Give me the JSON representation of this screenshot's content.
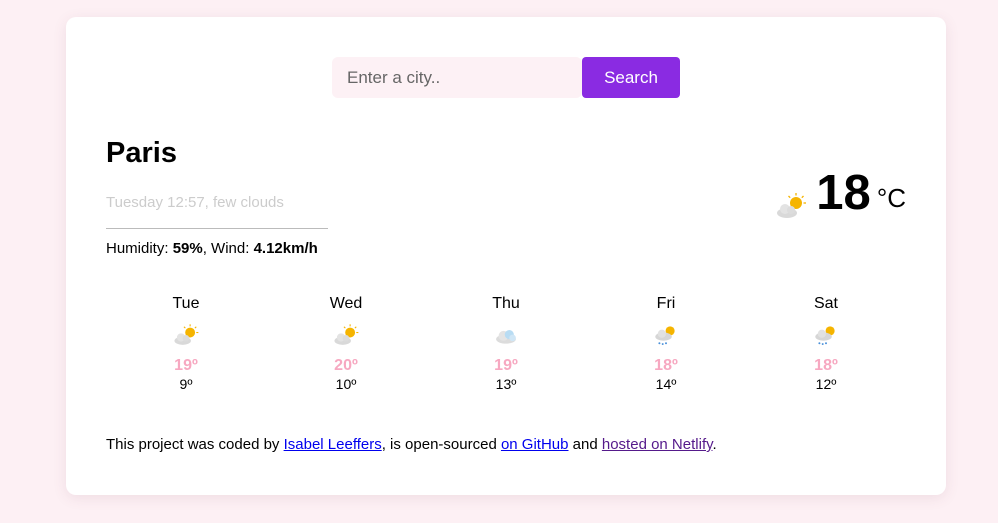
{
  "search": {
    "placeholder": "Enter a city..",
    "button_label": "Search"
  },
  "current": {
    "city": "Paris",
    "description": "Tuesday 12:57, few clouds",
    "humidity_label": "Humidity: ",
    "humidity_value": "59%",
    "wind_label": ", Wind: ",
    "wind_value": "4.12km/h",
    "temperature": "18",
    "unit": "°C",
    "icon": "few-clouds-icon"
  },
  "forecast": [
    {
      "day": "Tue",
      "max": "19º",
      "min": "9º",
      "icon": "few-clouds-icon"
    },
    {
      "day": "Wed",
      "max": "20º",
      "min": "10º",
      "icon": "few-clouds-icon"
    },
    {
      "day": "Thu",
      "max": "19º",
      "min": "13º",
      "icon": "cloud-icon"
    },
    {
      "day": "Fri",
      "max": "18º",
      "min": "14º",
      "icon": "rain-icon"
    },
    {
      "day": "Sat",
      "max": "18º",
      "min": "12º",
      "icon": "rain-icon"
    }
  ],
  "footer": {
    "text_1": "This project was coded by ",
    "link_1": "Isabel Leeffers",
    "text_2": ", is open-sourced ",
    "link_2": "on GitHub",
    "text_3": " and ",
    "link_3": "hosted on Netlify",
    "text_4": "."
  },
  "colors": {
    "accent": "#8a2be2",
    "background": "#fdf0f4",
    "max_temp": "#f7a8c1"
  }
}
